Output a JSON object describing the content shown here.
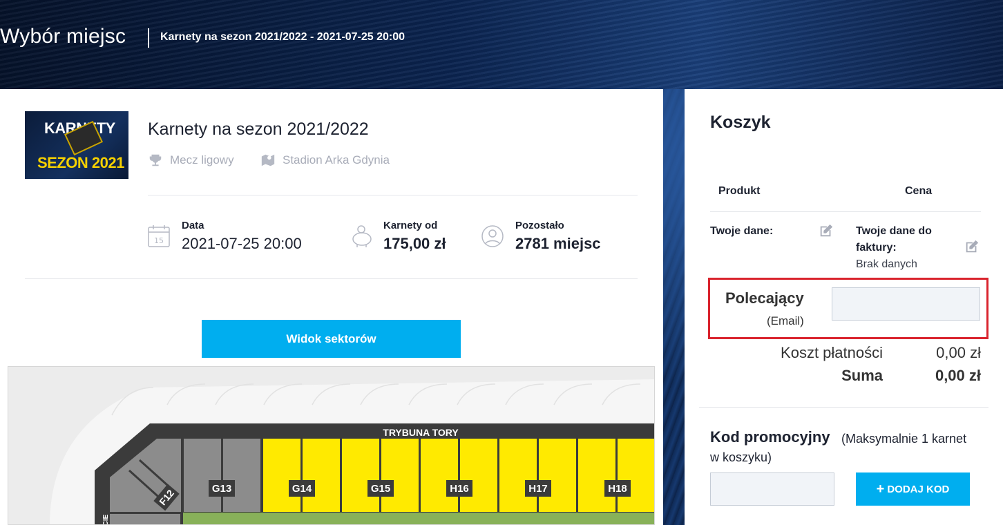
{
  "header": {
    "title": "Wybór miejsc",
    "subtitle": "Karnety na sezon 2021/2022 - 2021-07-25 20:00"
  },
  "event": {
    "thumbnail": {
      "line1": "KARNETY",
      "line2": "SEZON 2021"
    },
    "title": "Karnety na sezon 2021/2022",
    "category": "Mecz ligowy",
    "category_icon": "trophy-icon",
    "venue": "Stadion Arka Gdynia",
    "venue_icon": "map-icon",
    "stats": [
      {
        "label": "Data",
        "value": "2021-07-25 20:00",
        "icon": "calendar-icon"
      },
      {
        "label": "Karnety od",
        "value": "175,00 zł",
        "icon": "piggy-bank-icon"
      },
      {
        "label": "Pozostało",
        "value": "2781 miejsc",
        "icon": "user-icon"
      }
    ],
    "sectors_button": "Widok sektorów"
  },
  "map": {
    "stand_label": "TRYBUNA TORY",
    "sectors": [
      "F12",
      "G13",
      "G14",
      "G15",
      "H16",
      "H17",
      "H18"
    ],
    "side_label": "CIE",
    "colors": {
      "available": "#ffea00",
      "unavailable": "#8c8c8c",
      "pitch": "#88b159",
      "outline": "#3b3b3b"
    }
  },
  "cart": {
    "title": "Koszyk",
    "col_product": "Produkt",
    "col_price": "Cena",
    "your_data_label": "Twoje dane:",
    "invoice_label_1": "Twoje dane do",
    "invoice_label_2": "faktury:",
    "invoice_value": "Brak danych",
    "referrer_label": "Polecający",
    "referrer_sub": "(Email)",
    "referrer_value": "",
    "payment_cost_label": "Koszt płatności",
    "payment_cost_value": "0,00 zł",
    "sum_label": "Suma",
    "sum_value": "0,00 zł"
  },
  "promo": {
    "title": "Kod promocyjny",
    "note_1": "(Maksymalnie 1 karnet",
    "note_2": "w koszyku)",
    "input_value": "",
    "button": "DODAJ KOD"
  },
  "colors": {
    "accent": "#00aeef",
    "highlight": "#d9232d",
    "text": "#1d2230"
  }
}
